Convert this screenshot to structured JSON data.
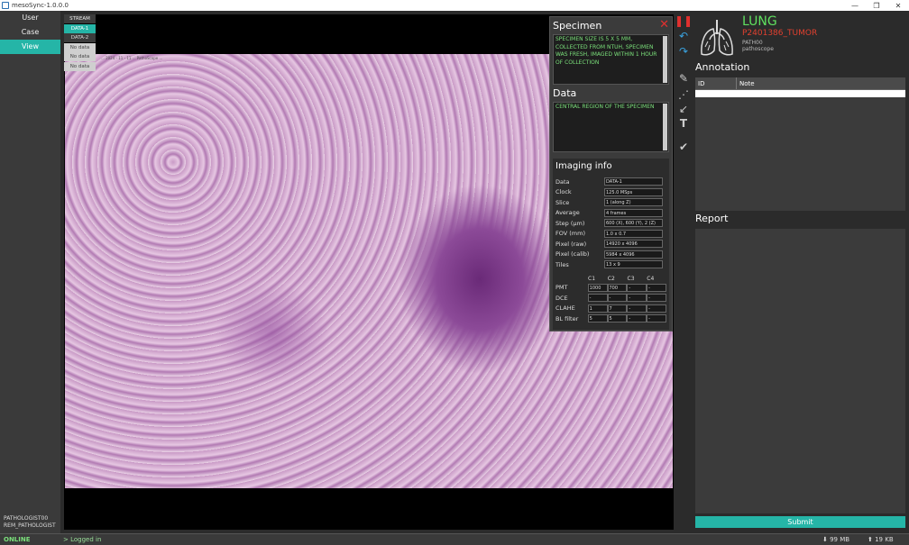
{
  "window": {
    "title": "mesoSync-1.0.0.0",
    "minimize": "—",
    "maximize": "❐",
    "close": "✕"
  },
  "nav": {
    "items": [
      {
        "label": "User"
      },
      {
        "label": "Case"
      },
      {
        "label": "View"
      }
    ],
    "active_index": 2
  },
  "user": {
    "line1": "PATHOLOGIST00",
    "line2": "REM_PATHOLOGIST"
  },
  "stream_menu": {
    "header": "STREAM",
    "items": [
      "DATA-1",
      "DATA-2",
      "No data",
      "No data",
      "No data"
    ]
  },
  "slide": {
    "label": "... 2024 - 11 - 11 ... PathoScope ..."
  },
  "specimen": {
    "title": "Specimen",
    "text": "SPECIMEN SIZE IS 5 X 5 MM, COLLECTED FROM NTUH, SPECIMEN WAS FRESH, IMAGED WITHIN 1 HOUR OF COLLECTION",
    "close_icon": "close-icon",
    "data_title": "Data",
    "data_text": "CENTRAL REGION OF THE SPECIMEN"
  },
  "imaging": {
    "title": "Imaging info",
    "rows": [
      {
        "key": "Data",
        "value": "DATA-1"
      },
      {
        "key": "Clock",
        "value": "125.0 MSps"
      },
      {
        "key": "Slice",
        "value": "1 (along Z)"
      },
      {
        "key": "Average",
        "value": "4 frames"
      },
      {
        "key": "Step (μm)",
        "value": "600 (X), 600 (Y), 2 (Z)"
      },
      {
        "key": "FOV (mm)",
        "value": "1.0 x 0.7"
      },
      {
        "key": "Pixel (raw)",
        "value": "14920 x 4096"
      },
      {
        "key": "Pixel (calib)",
        "value": "5984 x 4096"
      },
      {
        "key": "Tiles",
        "value": "13 x 9"
      }
    ],
    "channels": [
      "C1",
      "C2",
      "C3",
      "C4"
    ],
    "grid": [
      {
        "key": "PMT",
        "values": [
          "1000",
          "700",
          "-",
          "-"
        ]
      },
      {
        "key": "DCE",
        "values": [
          "-",
          "-",
          "-",
          "-"
        ]
      },
      {
        "key": "CLAHE",
        "values": [
          "1",
          "7",
          "-",
          "-"
        ]
      },
      {
        "key": "BL filter",
        "values": [
          "5",
          "5",
          "-",
          "-"
        ]
      }
    ]
  },
  "toolbar": {
    "icons": [
      "pause-icon",
      "undo-icon",
      "redo-icon",
      "pen-icon",
      "dotted-line-icon",
      "arrow-icon",
      "text-icon",
      "check-icon"
    ]
  },
  "case": {
    "organ": "LUNG",
    "id": "P2401386_TUMOR",
    "sub1": "PATH00",
    "sub2": "pathoscope"
  },
  "annotation": {
    "title": "Annotation",
    "columns": [
      "ID",
      "Note"
    ]
  },
  "report": {
    "title": "Report"
  },
  "submit_label": "Submit",
  "status": {
    "online": "ONLINE",
    "log": "> Logged in",
    "download": "⬇ 99 MB",
    "upload": "⬆ 19 KB"
  },
  "colors": {
    "accent": "#25b5a7",
    "online": "#7be07b",
    "organ": "#5fe05f",
    "case_id": "#e0402f",
    "close": "#e0302f"
  }
}
